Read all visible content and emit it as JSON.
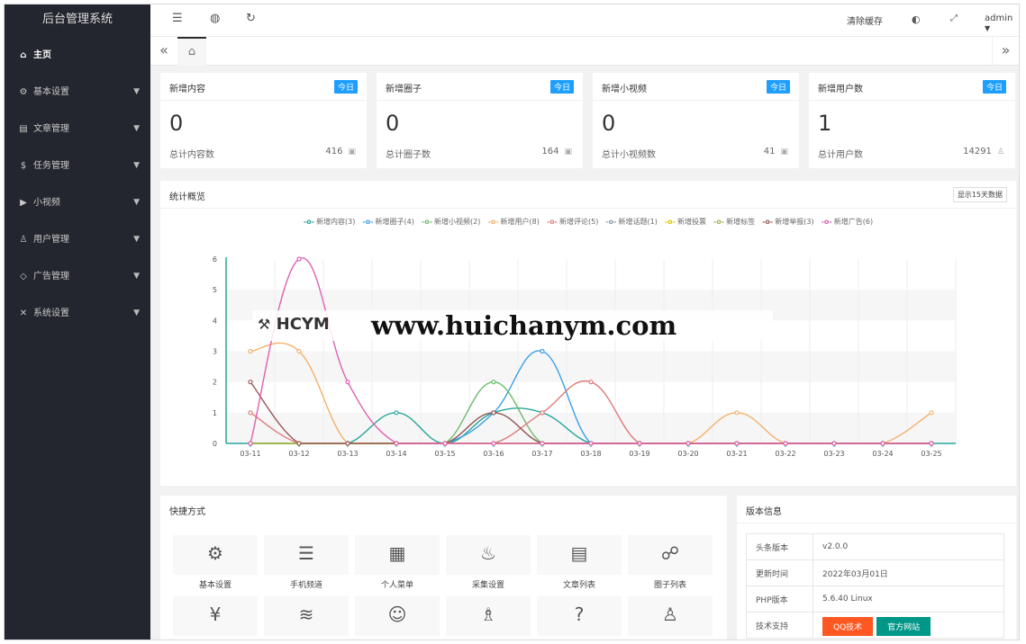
{
  "sidebar": {
    "title": "后台管理系统",
    "items": [
      {
        "label": "主页",
        "icon": "home-icon",
        "glyph": "⌂",
        "active": true,
        "caret": false
      },
      {
        "label": "基本设置",
        "icon": "gear-icon",
        "glyph": "⚙",
        "active": false,
        "caret": true
      },
      {
        "label": "文章管理",
        "icon": "document-icon",
        "glyph": "▤",
        "active": false,
        "caret": true
      },
      {
        "label": "任务管理",
        "icon": "dollar-icon",
        "glyph": "$",
        "active": false,
        "caret": true
      },
      {
        "label": "小视频",
        "icon": "play-icon",
        "glyph": "▶",
        "active": false,
        "caret": true
      },
      {
        "label": "用户管理",
        "icon": "user-icon",
        "glyph": "♙",
        "active": false,
        "caret": true
      },
      {
        "label": "广告管理",
        "icon": "tag-icon",
        "glyph": "◇",
        "active": false,
        "caret": true
      },
      {
        "label": "系统设置",
        "icon": "tools-icon",
        "glyph": "✕",
        "active": false,
        "caret": true
      }
    ]
  },
  "header": {
    "clear_cache": "清除缓存",
    "user": "admin"
  },
  "stats": [
    {
      "title": "新增内容",
      "badge": "今日",
      "value": "0",
      "sub": "总计内容数",
      "total": "416"
    },
    {
      "title": "新增圈子",
      "badge": "今日",
      "value": "0",
      "sub": "总计圈子数",
      "total": "164"
    },
    {
      "title": "新增小视频",
      "badge": "今日",
      "value": "0",
      "sub": "总计小视频数",
      "total": "41"
    },
    {
      "title": "新增用户数",
      "badge": "今日",
      "value": "1",
      "sub": "总计用户数",
      "total": "14291"
    }
  ],
  "overview": {
    "title": "统计概览",
    "button": "显示15天数据"
  },
  "chart_data": {
    "type": "line",
    "smooth": true,
    "categories": [
      "03-11",
      "03-12",
      "03-13",
      "03-14",
      "03-15",
      "03-16",
      "03-17",
      "03-18",
      "03-19",
      "03-20",
      "03-21",
      "03-22",
      "03-23",
      "03-24",
      "03-25"
    ],
    "ylim": [
      0,
      6
    ],
    "yticks": [
      0,
      1,
      2,
      3,
      4,
      5,
      6
    ],
    "grid": "horizontal-bands",
    "legend_position": "top",
    "series": [
      {
        "name": "新增内容(3)",
        "color": "#26a69a",
        "values": [
          0,
          0,
          0,
          1,
          0,
          1,
          1,
          0,
          0,
          0,
          0,
          0,
          0,
          0,
          0
        ]
      },
      {
        "name": "新增圈子(4)",
        "color": "#3ba0e6",
        "values": [
          0,
          0,
          0,
          0,
          0,
          1,
          3,
          0,
          0,
          0,
          0,
          0,
          0,
          0,
          0
        ]
      },
      {
        "name": "新增小视频(2)",
        "color": "#6dbb6d",
        "values": [
          0,
          0,
          0,
          0,
          0,
          2,
          0,
          0,
          0,
          0,
          0,
          0,
          0,
          0,
          0
        ]
      },
      {
        "name": "新增用户(8)",
        "color": "#f5b06b",
        "values": [
          3,
          3,
          0,
          0,
          0,
          0,
          0,
          0,
          0,
          0,
          1,
          0,
          0,
          0,
          1
        ]
      },
      {
        "name": "新增评论(5)",
        "color": "#e07b7b",
        "values": [
          1,
          0,
          0,
          0,
          0,
          0,
          1,
          2,
          0,
          0,
          0,
          0,
          0,
          0,
          0
        ]
      },
      {
        "name": "新增话题(1)",
        "color": "#8a9cad",
        "values": [
          0,
          0,
          0,
          0,
          0,
          1,
          0,
          0,
          0,
          0,
          0,
          0,
          0,
          0,
          0
        ]
      },
      {
        "name": "新增投票",
        "color": "#e6c200",
        "values": [
          0,
          0,
          0,
          0,
          0,
          0,
          0,
          0,
          0,
          0,
          0,
          0,
          0,
          0,
          0
        ]
      },
      {
        "name": "新增标签",
        "color": "#9ab84a",
        "values": [
          0,
          0,
          0,
          0,
          0,
          0,
          0,
          0,
          0,
          0,
          0,
          0,
          0,
          0,
          0
        ]
      },
      {
        "name": "新增举报(3)",
        "color": "#9a5a5a",
        "values": [
          2,
          0,
          0,
          0,
          0,
          1,
          0,
          0,
          0,
          0,
          0,
          0,
          0,
          0,
          0
        ]
      },
      {
        "name": "新增广告(6)",
        "color": "#e060b0",
        "values": [
          0,
          6,
          2,
          0,
          0,
          0,
          0,
          0,
          0,
          0,
          0,
          0,
          0,
          0,
          0
        ]
      }
    ]
  },
  "quick": {
    "title": "快捷方式",
    "items": [
      {
        "label": "基本设置",
        "icon": "gear-icon",
        "glyph": "⚙"
      },
      {
        "label": "手机频道",
        "icon": "menu-lines-icon",
        "glyph": "☰"
      },
      {
        "label": "个人菜单",
        "icon": "grid-icon",
        "glyph": "▦"
      },
      {
        "label": "采集设置",
        "icon": "fire-icon",
        "glyph": "♨"
      },
      {
        "label": "文章列表",
        "icon": "clipboard-icon",
        "glyph": "▤"
      },
      {
        "label": "圈子列表",
        "icon": "chat-icon",
        "glyph": "☍"
      },
      {
        "label": "",
        "icon": "yen-icon",
        "glyph": "¥"
      },
      {
        "label": "",
        "icon": "layers-icon",
        "glyph": "≋"
      },
      {
        "label": "",
        "icon": "smile-icon",
        "glyph": "☺"
      },
      {
        "label": "",
        "icon": "users-icon",
        "glyph": "♗"
      },
      {
        "label": "",
        "icon": "help-doc-icon",
        "glyph": "?"
      },
      {
        "label": "",
        "icon": "person-icon",
        "glyph": "♙"
      }
    ]
  },
  "version": {
    "title": "版本信息",
    "rows": [
      {
        "key": "头条版本",
        "value": "v2.0.0"
      },
      {
        "key": "更新时间",
        "value": "2022年03月01日"
      },
      {
        "key": "PHP版本",
        "value": "5.6.40 Linux"
      }
    ],
    "support_label": "技术支持",
    "btn_qq": "QQ技术",
    "btn_site": "官方网站",
    "btn_qq_color": "#ff5722",
    "btn_site_color": "#009688"
  },
  "watermark": {
    "logo": "HCYM",
    "text": "www.huichanym.com"
  }
}
